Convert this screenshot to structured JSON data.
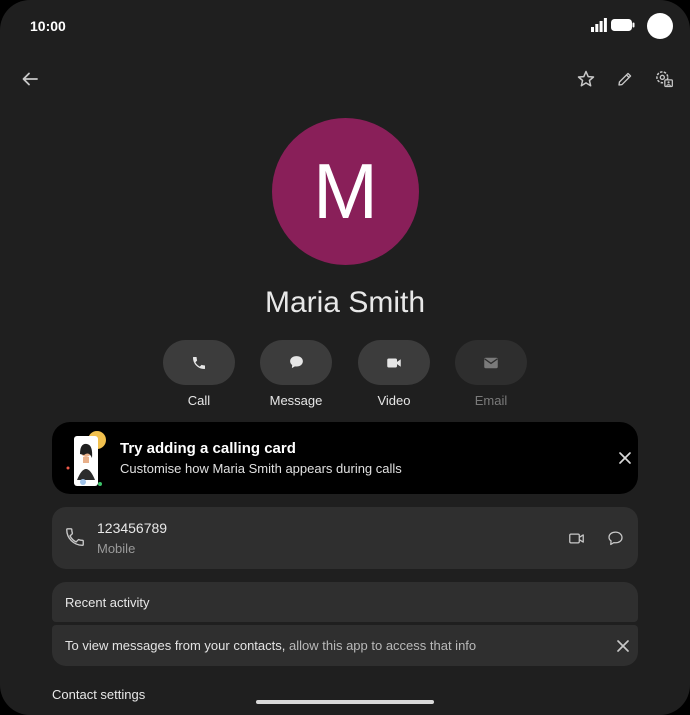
{
  "status_bar": {
    "time": "10:00"
  },
  "toolbar": {
    "back_icon": "arrow-back-icon",
    "favorite_icon": "star-outline-icon",
    "edit_icon": "pencil-icon",
    "settings_icon": "contact-settings-icon"
  },
  "contact": {
    "initial": "M",
    "name": "Maria Smith",
    "avatar_color": "#891f59"
  },
  "actions": [
    {
      "label": "Call",
      "icon": "phone-icon",
      "enabled": true
    },
    {
      "label": "Message",
      "icon": "chat-bubble-icon",
      "enabled": true
    },
    {
      "label": "Video",
      "icon": "videocam-icon",
      "enabled": true
    },
    {
      "label": "Email",
      "icon": "mail-icon",
      "enabled": false
    }
  ],
  "calling_card_banner": {
    "title": "Try adding a calling card",
    "subtitle": "Customise how Maria Smith appears during calls"
  },
  "phone_entry": {
    "number": "123456789",
    "type": "Mobile"
  },
  "recent_activity": {
    "title": "Recent activity",
    "permission_text": "To view messages from your contacts, ",
    "permission_link": "allow this app to access that info"
  },
  "contact_settings": {
    "label": "Contact settings"
  }
}
